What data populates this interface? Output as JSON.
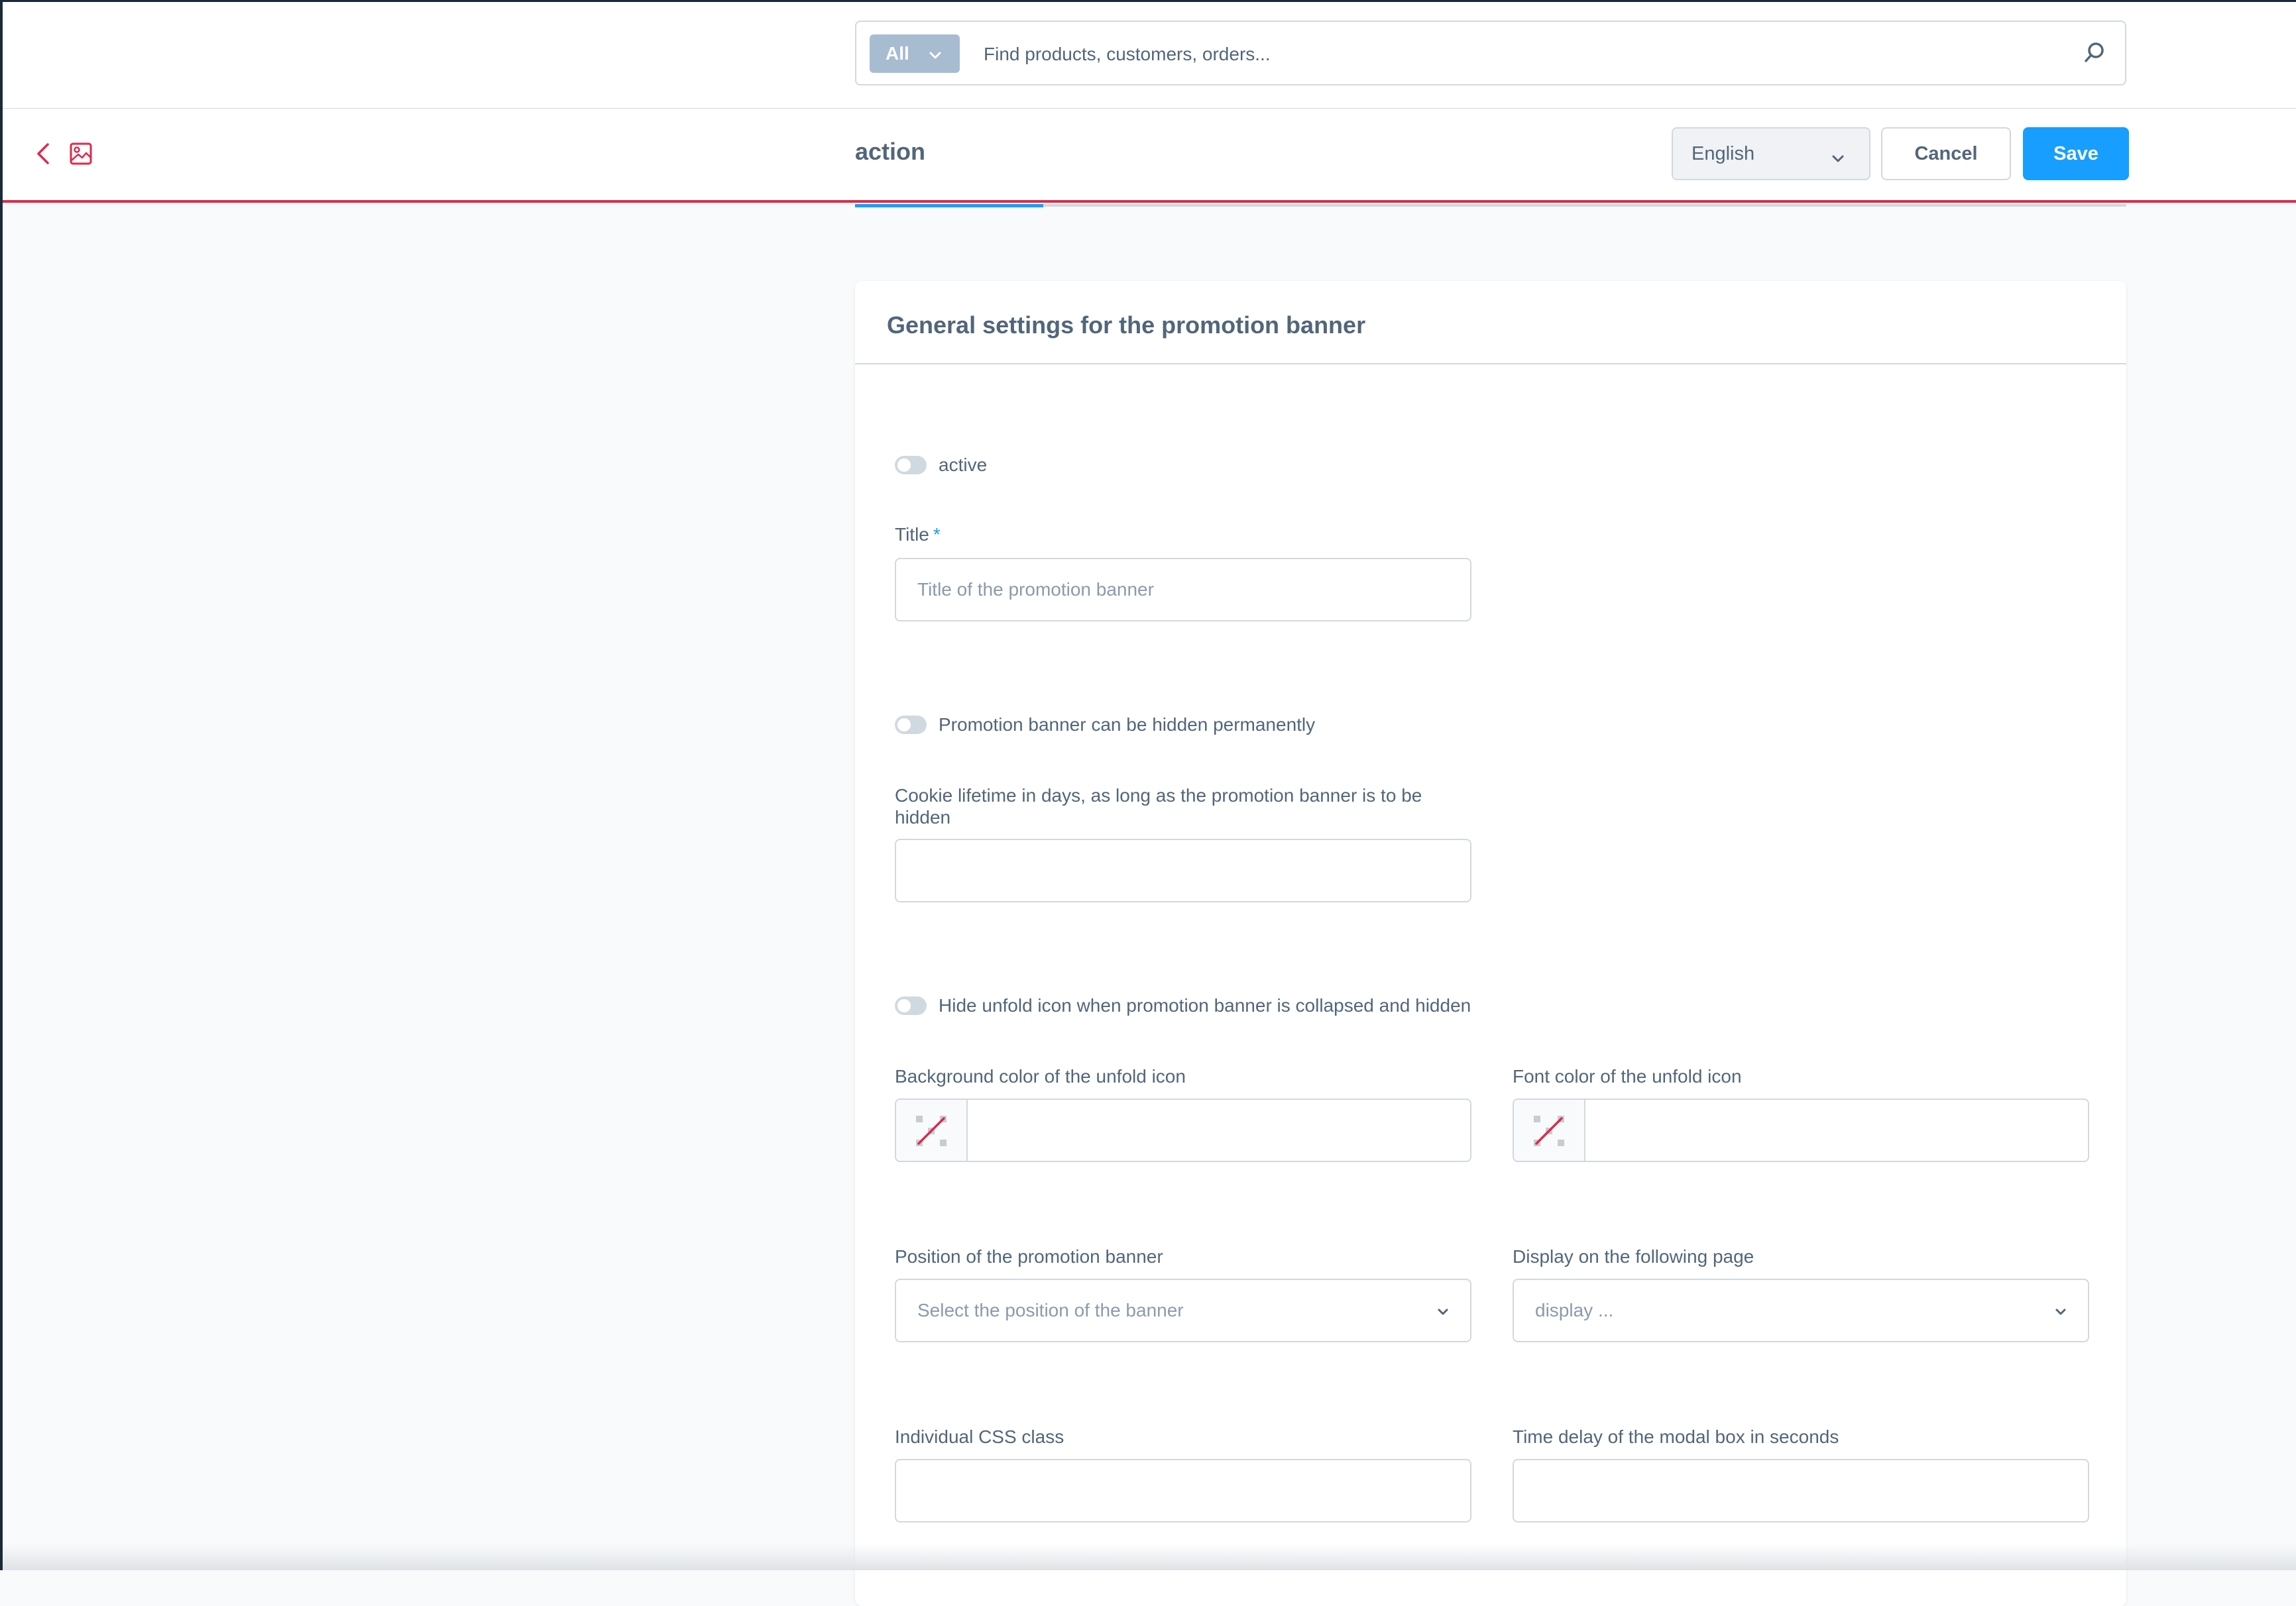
{
  "search": {
    "type_label": "All",
    "placeholder": "Find products, customers, orders..."
  },
  "smartbar": {
    "title": "action",
    "language": "English",
    "cancel_label": "Cancel",
    "save_label": "Save"
  },
  "card": {
    "title": "General settings for the promotion banner",
    "active_label": "active",
    "title_label": "Title",
    "required_mark": "*",
    "title_placeholder": "Title of the promotion banner",
    "hide_permanently_label": "Promotion banner can be hidden permanently",
    "cookie_lifetime_label": "Cookie lifetime in days, as long as the promotion banner is to be hidden",
    "hide_unfold_icon_label": "Hide unfold icon when promotion banner is collapsed and hidden",
    "bg_color_label": "Background color of the unfold icon",
    "font_color_label": "Font color of the unfold icon",
    "position_label": "Position of the promotion banner",
    "position_placeholder": "Select the position of the banner",
    "display_page_label": "Display on the following page",
    "display_page_placeholder": "display ...",
    "css_class_label": "Individual CSS class",
    "time_delay_label": "Time delay of the modal box in seconds"
  },
  "colors": {
    "primary": "#189eff",
    "accent_red": "#de294c",
    "text": "#52667a",
    "border": "#d1d9e0"
  }
}
